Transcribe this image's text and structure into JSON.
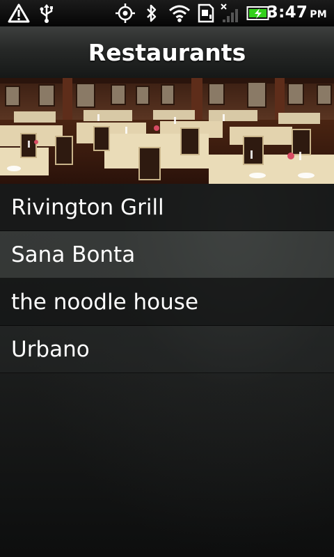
{
  "status_bar": {
    "time": "3:47",
    "ampm": "PM",
    "icons": [
      "warning-icon",
      "usb-icon",
      "gps-icon",
      "bluetooth-icon",
      "wifi-icon",
      "sd-card-icon",
      "no-signal-icon",
      "battery-charging-icon"
    ]
  },
  "header": {
    "title": "Restaurants"
  },
  "banner": {
    "image": "restaurant-dining-room-photo"
  },
  "restaurants": [
    "Rivington Grill",
    "Sana Bonta",
    "the noodle house",
    "Urbano"
  ],
  "colors": {
    "status_bar_bg": "#0a0a0a",
    "title_bar_bg": "#2a2c2b",
    "list_text": "#ffffff",
    "battery_green": "#33d11b"
  }
}
